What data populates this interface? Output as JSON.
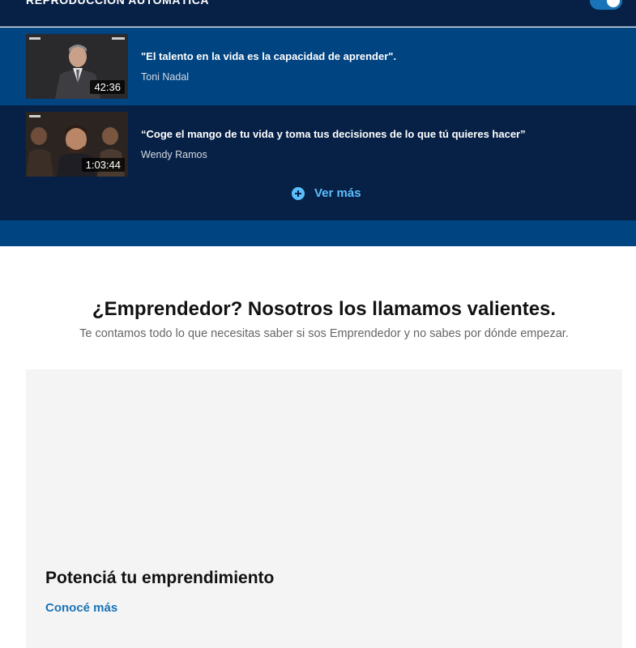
{
  "autoplay": {
    "label": "REPRODUCCIÓN AUTOMÁTICA",
    "enabled": true
  },
  "videos": [
    {
      "title": "\"El talento en la vida es la capacidad de aprender\".",
      "author": "Toni Nadal",
      "duration": "42:36",
      "active": true
    },
    {
      "title": "“Coge el mango de tu vida y toma tus decisiones de lo que tú quieres hacer”",
      "author": "Wendy Ramos",
      "duration": "1:03:44",
      "active": false
    }
  ],
  "more": {
    "label": "Ver más",
    "icon": "plus-circle-icon"
  },
  "section": {
    "title": "¿Emprendedor? Nosotros los llamamos valientes.",
    "subtitle": "Te contamos todo lo que necesitas saber si sos Emprendedor y no sabes por dónde empezar."
  },
  "card": {
    "title": "Potenciá tu emprendimiento",
    "link": "Conocé más"
  },
  "colors": {
    "navy": "#072146",
    "active_blue": "#004481",
    "accent": "#1973b8",
    "light_blue": "#5bbeff"
  }
}
